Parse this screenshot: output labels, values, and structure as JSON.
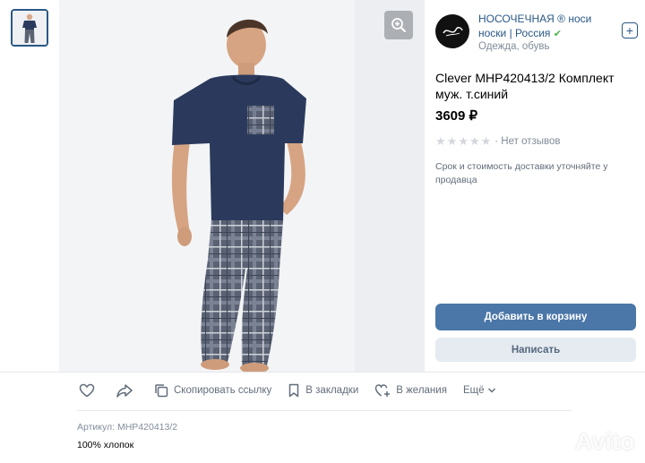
{
  "seller": {
    "name": "НОСОЧЕЧНАЯ ® носи носки | Россия",
    "verified_mark": "✔",
    "category": "Одежда, обувь",
    "follow_icon": "plus-icon"
  },
  "product": {
    "title": "Clever MHP420413/2 Комплект муж. т.синий",
    "price": "3609 ₽",
    "rating_text": "· Нет отзывов",
    "stars_total": 5,
    "stars_filled": 0,
    "delivery_note": "Срок и стоимость доставки уточняйте у продавца"
  },
  "buttons": {
    "add_to_cart": "Добавить в корзину",
    "write": "Написать"
  },
  "actions": {
    "copy_link": "Скопировать ссылку",
    "bookmarks": "В закладки",
    "wishlist": "В желания",
    "more": "Ещё"
  },
  "details": {
    "article": "Артикул: MHP420413/2",
    "material": "100% хлопок"
  },
  "watermark": "Avito",
  "colors": {
    "accent": "#4a76a8",
    "link": "#2a5885",
    "verified": "#4bb34b",
    "shirt": "#2b3a5c",
    "trousers": "#5a6273"
  }
}
